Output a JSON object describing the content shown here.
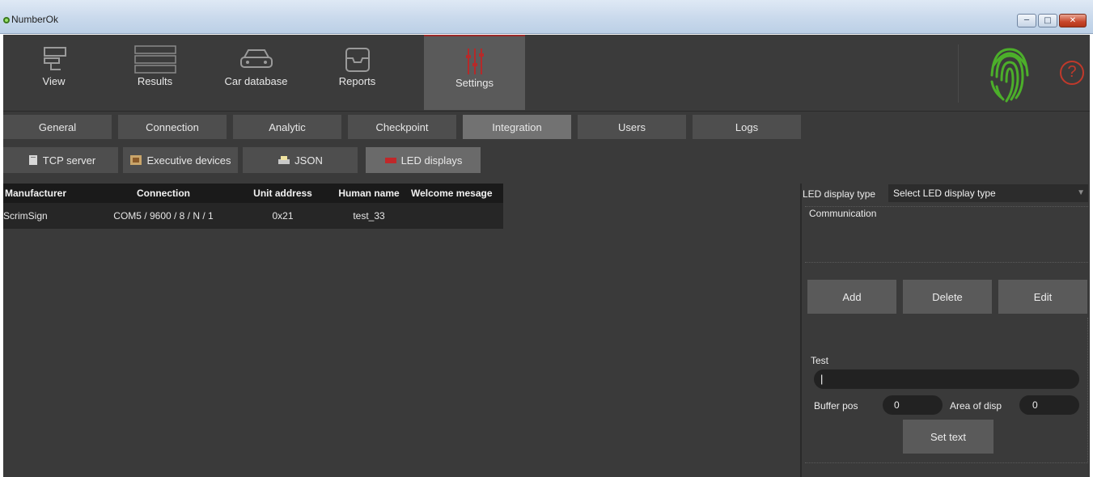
{
  "window": {
    "title": "NumberOk",
    "controls": {
      "minimize": "─",
      "maximize": "□",
      "close": "✕"
    }
  },
  "topnav": {
    "items": [
      {
        "label": "View",
        "icon": "camera-icon"
      },
      {
        "label": "Results",
        "icon": "results-list-icon"
      },
      {
        "label": "Car database",
        "icon": "car-icon"
      },
      {
        "label": "Reports",
        "icon": "inbox-icon"
      },
      {
        "label": "Settings",
        "icon": "sliders-icon",
        "active": true
      }
    ],
    "help": "?"
  },
  "tabs": [
    {
      "label": "General"
    },
    {
      "label": "Connection"
    },
    {
      "label": "Analytic"
    },
    {
      "label": "Checkpoint"
    },
    {
      "label": "Integration",
      "active": true
    },
    {
      "label": "Users"
    },
    {
      "label": "Logs"
    }
  ],
  "subtabs": [
    {
      "label": "TCP server",
      "icon": "server-icon"
    },
    {
      "label": "Executive devices",
      "icon": "device-icon"
    },
    {
      "label": "JSON",
      "icon": "json-icon"
    },
    {
      "label": "LED displays",
      "icon": "led-icon",
      "active": true
    }
  ],
  "table": {
    "columns": [
      "Manufacturer",
      "Connection",
      "Unit address",
      "Human name",
      "Welcome mesage"
    ],
    "rows": [
      [
        "ScrimSign",
        "COM5 / 9600 / 8 / N / 1",
        "0x21",
        "test_33",
        ""
      ]
    ]
  },
  "panel": {
    "led_type_label": "LED display type",
    "led_type_value": "Select LED display type",
    "communication_label": "Communication",
    "add_label": "Add",
    "delete_label": "Delete",
    "edit_label": "Edit",
    "test_label": "Test",
    "test_value": "|",
    "buffer_pos_label": "Buffer pos",
    "buffer_pos_value": "0",
    "area_label": "Area of disp",
    "area_value": "0",
    "set_text_label": "Set text"
  },
  "colors": {
    "background": "#3a3a3a",
    "tab": "#4e4e4e",
    "tab_active": "#727272",
    "accent_red": "#c0392b",
    "fingerprint_green": "#4caf2a"
  }
}
